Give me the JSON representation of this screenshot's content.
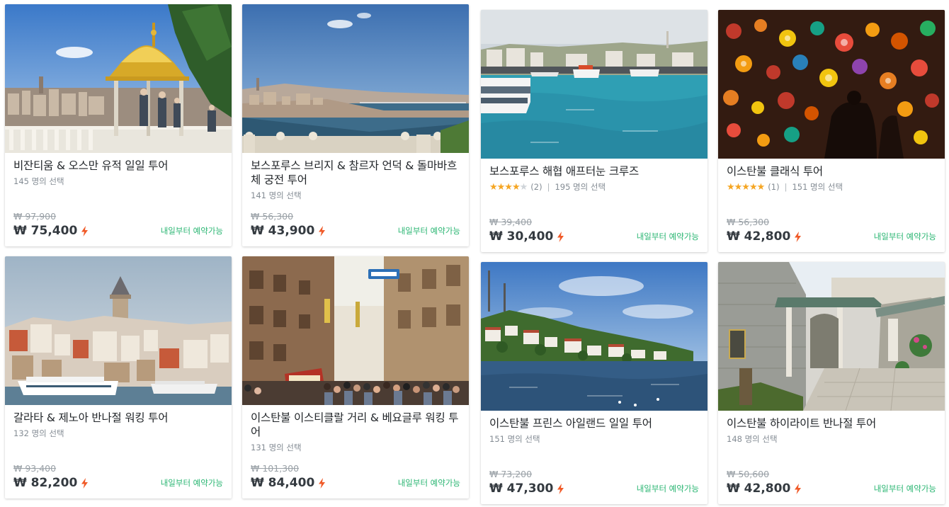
{
  "currency": "₩",
  "accent_color": "#f05a28",
  "availability_color": "#2bb673",
  "rating_color": "#f5a623",
  "cards": [
    {
      "title": "비잔티움 & 오스만 유적 일일 투어",
      "picks": "145 명의 선택",
      "orig_price": "₩ 97,900",
      "price": "₩ 75,400",
      "availability": "내일부터 예약가능",
      "image": "topkapi-pavilion"
    },
    {
      "title": "보스포루스 브리지 & 참르자 언덕 & 돌마바흐체 궁전 투어",
      "picks": "141 명의 선택",
      "orig_price": "₩ 56,300",
      "price": "₩ 43,900",
      "availability": "내일부터 예약가능",
      "image": "golden-horn-view"
    },
    {
      "title": "보스포루스 해협 애프터눈 크루즈",
      "rating_stars": "★★★★",
      "rating_stars_off": "★",
      "rating_count": "(2)",
      "separator": "|",
      "picks": "195 명의 선택",
      "orig_price": "₩ 39,400",
      "price": "₩ 30,400",
      "availability": "내일부터 예약가능",
      "image": "bosphorus-ferry"
    },
    {
      "title": "이스탄불 클래식 투어",
      "rating_stars": "★★★★★",
      "rating_stars_off": "",
      "rating_count": "(1)",
      "separator": "|",
      "picks": "151 명의 선택",
      "orig_price": "₩ 56,300",
      "price": "₩ 42,800",
      "availability": "내일부터 예약가능",
      "image": "bazaar-lamps"
    },
    {
      "title": "갈라타 & 제노아 반나절 워킹 투어",
      "picks": "132 명의 선택",
      "orig_price": "₩ 93,400",
      "price": "₩ 82,200",
      "availability": "내일부터 예약가능",
      "image": "galata-tower"
    },
    {
      "title": "이스탄불 이스티클랄 거리 & 베요글루 워킹 투어",
      "picks": "131 명의 선택",
      "orig_price": "₩ 101,300",
      "price": "₩ 84,400",
      "availability": "내일부터 예약가능",
      "image": "istiklal-street"
    },
    {
      "title": "이스탄불 프린스 아일랜드 일일 투어",
      "picks": "151 명의 선택",
      "orig_price": "₩ 73,200",
      "price": "₩ 47,300",
      "availability": "내일부터 예약가능",
      "image": "princes-island"
    },
    {
      "title": "이스탄불 하이라이트 반나절 투어",
      "picks": "148 명의 선택",
      "orig_price": "₩ 50,600",
      "price": "₩ 42,800",
      "availability": "내일부터 예약가능",
      "image": "mosque-courtyard"
    }
  ]
}
